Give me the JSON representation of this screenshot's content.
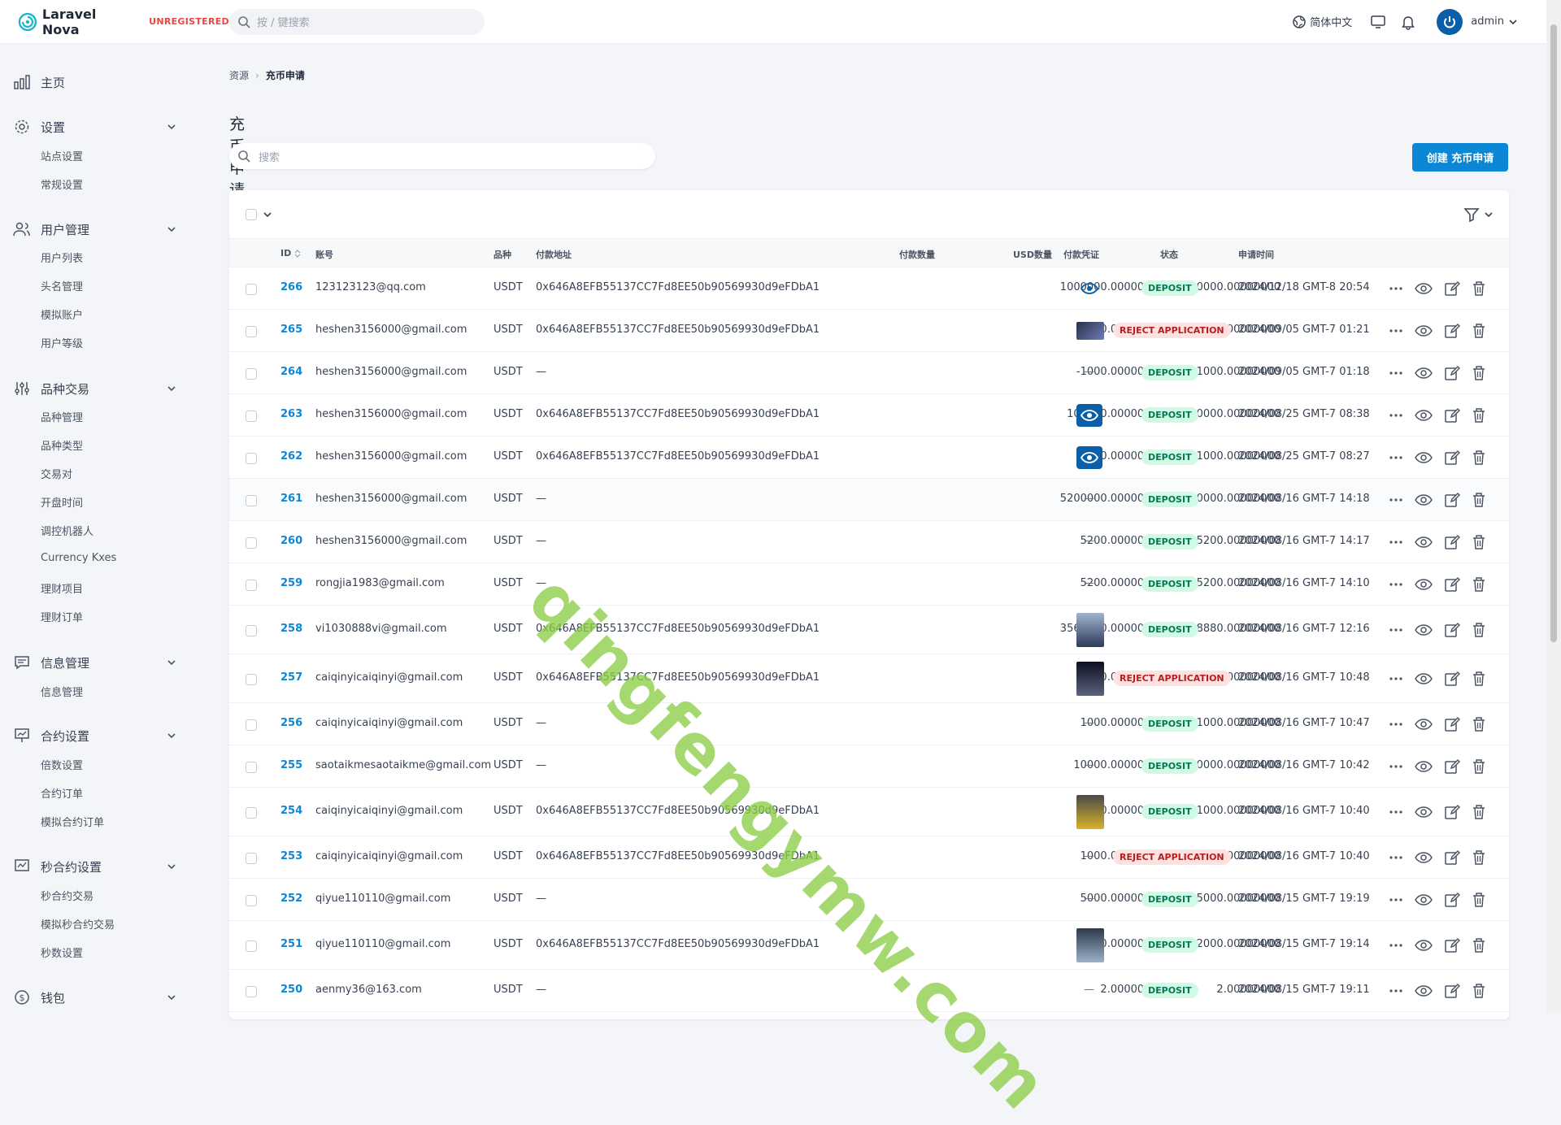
{
  "app": {
    "name": "Laravel Nova",
    "license": "UNREGISTERED"
  },
  "search": {
    "placeholder": "按 / 键搜索"
  },
  "topbar": {
    "language": "简体中文",
    "user": "admin"
  },
  "sidebar": {
    "home": "主页",
    "settings": {
      "label": "设置",
      "items": [
        "站点设置",
        "常规设置"
      ]
    },
    "users": {
      "label": "用户管理",
      "items": [
        "用户列表",
        "头名管理",
        "模拟账户",
        "用户等级"
      ]
    },
    "trade": {
      "label": "品种交易",
      "items": [
        "品种管理",
        "品种类型",
        "交易对",
        "开盘时间",
        "调控机器人",
        "Currency Kxes",
        "理财项目",
        "理财订单"
      ]
    },
    "info": {
      "label": "信息管理",
      "items": [
        "信息管理"
      ]
    },
    "contract": {
      "label": "合约设置",
      "items": [
        "倍数设置",
        "合约订单",
        "模拟合约订单"
      ]
    },
    "seconds": {
      "label": "秒合约设置",
      "items": [
        "秒合约交易",
        "模拟秒合约交易",
        "秒数设置"
      ]
    },
    "wallet": {
      "label": "钱包"
    }
  },
  "breadcrumb": {
    "root": "资源",
    "current": "充币申请"
  },
  "page": {
    "title": "充币申请",
    "search_placeholder": "搜索",
    "create_label": "创建 充币申请"
  },
  "table": {
    "columns": {
      "id": "ID",
      "account": "账号",
      "coin": "品种",
      "address": "付款地址",
      "amount": "付款数量",
      "usd": "USD数量",
      "proof": "付款凭证",
      "status": "状态",
      "time": "申请时间"
    },
    "rows": [
      {
        "id": "266",
        "account": "123123123@qq.com",
        "coin": "USDT",
        "address": "0x646A8EFB55137CC7Fd8EE50b90569930d9eFDbA1",
        "amount": "1000000.00000000",
        "usd": "1000000.00000000",
        "proof": "eye",
        "status": "DEPOSIT",
        "time": "2024/12/18 GMT-8 20:54"
      },
      {
        "id": "265",
        "account": "heshen3156000@gmail.com",
        "coin": "USDT",
        "address": "0x646A8EFB55137CC7Fd8EE50b90569930d9eFDbA1",
        "amount": "100.00000000",
        "usd": "100.00000000",
        "proof": "photo",
        "status": "REJECT APPLICATION",
        "time": "2024/09/05 GMT-7 01:21"
      },
      {
        "id": "264",
        "account": "heshen3156000@gmail.com",
        "coin": "USDT",
        "address": "—",
        "amount": "-1000.00000000",
        "usd": "-1000.00000000",
        "proof": "—",
        "status": "DEPOSIT",
        "time": "2024/09/05 GMT-7 01:18"
      },
      {
        "id": "263",
        "account": "heshen3156000@gmail.com",
        "coin": "USDT",
        "address": "0x646A8EFB55137CC7Fd8EE50b90569930d9eFDbA1",
        "amount": "100000.00000000",
        "usd": "100000.00000000",
        "proof": "eye-blue",
        "status": "DEPOSIT",
        "time": "2024/08/25 GMT-7 08:38"
      },
      {
        "id": "262",
        "account": "heshen3156000@gmail.com",
        "coin": "USDT",
        "address": "0x646A8EFB55137CC7Fd8EE50b90569930d9eFDbA1",
        "amount": "1000.00000000",
        "usd": "1000.00000000",
        "proof": "eye-blue",
        "status": "DEPOSIT",
        "time": "2024/08/25 GMT-7 08:27"
      },
      {
        "id": "261",
        "account": "heshen3156000@gmail.com",
        "coin": "USDT",
        "address": "—",
        "amount": "5200000.00000000",
        "usd": "5200000.00000000",
        "proof": "—",
        "status": "DEPOSIT",
        "time": "2024/08/16 GMT-7 14:18"
      },
      {
        "id": "260",
        "account": "heshen3156000@gmail.com",
        "coin": "USDT",
        "address": "—",
        "amount": "5200.00000000",
        "usd": "5200.00000000",
        "proof": "—",
        "status": "DEPOSIT",
        "time": "2024/08/16 GMT-7 14:17"
      },
      {
        "id": "259",
        "account": "rongjia1983@gmail.com",
        "coin": "USDT",
        "address": "—",
        "amount": "5200.00000000",
        "usd": "5200.00000000",
        "proof": "—",
        "status": "DEPOSIT",
        "time": "2024/08/16 GMT-7 14:10"
      },
      {
        "id": "258",
        "account": "vi1030888vi@gmail.com",
        "coin": "USDT",
        "address": "0x646A8EFB55137CC7Fd8EE50b90569930d9eFDbA1",
        "amount": "3568880.00000000",
        "usd": "3568880.00000000",
        "proof": "photo-tall",
        "status": "DEPOSIT",
        "time": "2024/08/16 GMT-7 12:16"
      },
      {
        "id": "257",
        "account": "caiqinyicaiqinyi@gmail.com",
        "coin": "USDT",
        "address": "0x646A8EFB55137CC7Fd8EE50b90569930d9eFDbA1",
        "amount": "100.00000000",
        "usd": "100.00000000",
        "proof": "photo-tall",
        "status": "REJECT APPLICATION",
        "time": "2024/08/16 GMT-7 10:48"
      },
      {
        "id": "256",
        "account": "caiqinyicaiqinyi@gmail.com",
        "coin": "USDT",
        "address": "—",
        "amount": "1000.00000000",
        "usd": "1000.00000000",
        "proof": "—",
        "status": "DEPOSIT",
        "time": "2024/08/16 GMT-7 10:47"
      },
      {
        "id": "255",
        "account": "saotaikmesaotaikme@gmail.com",
        "coin": "USDT",
        "address": "—",
        "amount": "10000.00000000",
        "usd": "10000.00000000",
        "proof": "—",
        "status": "DEPOSIT",
        "time": "2024/08/16 GMT-7 10:42"
      },
      {
        "id": "254",
        "account": "caiqinyicaiqinyi@gmail.com",
        "coin": "USDT",
        "address": "0x646A8EFB55137CC7Fd8EE50b90569930d9eFDbA1",
        "amount": "1000.00000000",
        "usd": "1000.00000000",
        "proof": "photo-tall",
        "status": "DEPOSIT",
        "time": "2024/08/16 GMT-7 10:40"
      },
      {
        "id": "253",
        "account": "caiqinyicaiqinyi@gmail.com",
        "coin": "USDT",
        "address": "0x646A8EFB55137CC7Fd8EE50b90569930d9eFDbA1",
        "amount": "1000.00000000",
        "usd": "1000.00000000",
        "proof": "—",
        "status": "REJECT APPLICATION",
        "time": "2024/08/16 GMT-7 10:40"
      },
      {
        "id": "252",
        "account": "qiyue110110@gmail.com",
        "coin": "USDT",
        "address": "—",
        "amount": "5000.00000000",
        "usd": "5000.00000000",
        "proof": "—",
        "status": "DEPOSIT",
        "time": "2024/08/15 GMT-7 19:19"
      },
      {
        "id": "251",
        "account": "qiyue110110@gmail.com",
        "coin": "USDT",
        "address": "0x646A8EFB55137CC7Fd8EE50b90569930d9eFDbA1",
        "amount": "2000.00000000",
        "usd": "2000.00000000",
        "proof": "photo-tall",
        "status": "DEPOSIT",
        "time": "2024/08/15 GMT-7 19:14"
      },
      {
        "id": "250",
        "account": "aenmy36@163.com",
        "coin": "USDT",
        "address": "—",
        "amount": "2.00000000",
        "usd": "2.00000000",
        "proof": "—",
        "status": "DEPOSIT",
        "time": "2024/08/15 GMT-7 19:11"
      }
    ]
  },
  "watermark": "qingfengymw.com",
  "colors": {
    "accent": "#0b87d6",
    "deposit_bg": "#d1fae5",
    "reject_bg": "#fee2e2"
  }
}
